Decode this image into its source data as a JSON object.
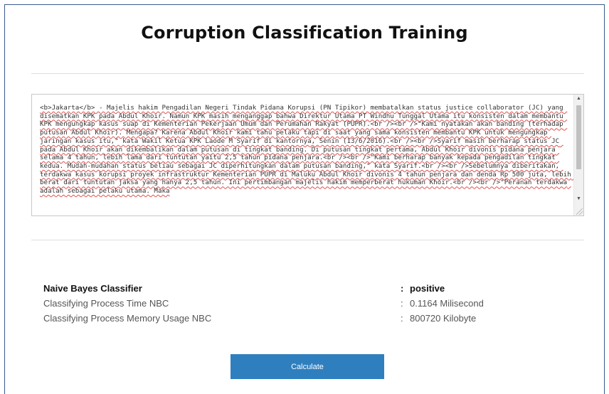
{
  "page": {
    "title": "Corruption Classification Training"
  },
  "textarea": {
    "value": "<b>Jakarta</b> - Majelis hakim Pengadilan Negeri Tindak Pidana Korupsi (PN Tipikor) membatalkan status justice collaborator (JC) yang disematkan KPK pada Abdul Khoir. Namun KPK masih menganggap bahwa Direktur Utama PT Windhu Tunggal Utama itu konsisten dalam membantu KPK mengungkap kasus suap di Kementerian Pekerjaan Umum dan Perumahan Rakyat (PUPR).<br /><br />\"Kami nyatakan akan banding (terhadap putusan Abdul Khoir). Mengapa? Karena Abdul Khoir kami tahu pelaku tapi di saat yang sama konsisten membantu KPK untuk mengungkap jaringan kasus itu,\" kata Wakil Ketua KPK Laode M Syarif di kantornya, Senin (13/6/2016).<br /><br />Syarif masih berharap status JC pada Abdul Khoir akan dikembalikan dalam putusan di tingkat banding. Di putusan tingkat pertama, Abdul Khoir divonis pidana penjara selama 4 tahun, lebih lama dari tuntutan yaitu 2,5 tahun pidana penjara.<br /><br />\"Kami berharap banyak kepada pengadilan tingkat kedua. Mudah-mudahan status beliau sebagai JC diperhitungkan dalam putusan banding,\" kata Syarif.<br /><br />Sebelumnya diberitakan, terdakwa kasus korupsi proyek infrastruktur Kementerian PUPR di Maluku Abdul Khoir divonis 4 tahun penjara dan denda Rp 500 juta, lebih berat dari tuntutan jaksa yang hanya 2,5 tahun. Ini pertimbangan majelis hakim memperberat hukuman Khoir.<br /><br />\"Peranan terdakwa adalah sebagai pelaku utama. Maka"
  },
  "results": {
    "classifier_label": "Naive Bayes Classifier",
    "classifier_value": "positive",
    "time_label": "Classifying Process Time NBC",
    "time_value": "0.1164 Milisecond",
    "memory_label": "Classifying Process Memory Usage NBC",
    "memory_value": "800720 Kilobyte",
    "separator": ":"
  },
  "actions": {
    "calculate_label": "Calculate"
  },
  "icons": {
    "scroll_up": "scroll-up-arrow",
    "scroll_down": "scroll-down-arrow"
  },
  "colors": {
    "button_bg": "#2f7fbf",
    "frame_border": "#3a5a8c",
    "spellcheck_underline": "#e05050"
  }
}
